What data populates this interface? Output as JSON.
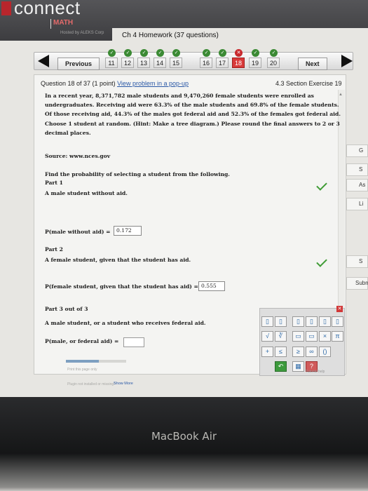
{
  "header": {
    "brand": "connect",
    "product": "MATH",
    "powered_by": "Hosted by ALEKS Corp",
    "assignment_title": "Ch 4 Homework (37 questions)"
  },
  "nav": {
    "previous_label": "Previous",
    "next_label": "Next",
    "questions": [
      "11",
      "12",
      "13",
      "14",
      "15",
      "16",
      "17",
      "18",
      "19",
      "20"
    ],
    "current_question": "18"
  },
  "question": {
    "header_prefix": "Question 18 of 37 (1 point)",
    "popup_link": "View problem in a pop-up",
    "section": "4.3 Section Exercise 19",
    "body": "In a recent year, 8,371,782 male students and 9,470,260 female students were enrolled as undergraduates. Receiving aid were 63.3% of the male students and 69.8% of the female students. Of those receiving aid, 44.3% of the males got federal aid and 52.3% of the females got federal aid. Choose 1 student at random. (Hint: Make a tree diagram.) Please round the final answers to 2 or 3 decimal places.",
    "source": "Source: www.nces.gov",
    "instruction": "Find the probability of selecting a student from the following."
  },
  "parts": {
    "part1_title": "Part 1",
    "part1_text": "A male student without aid.",
    "part1_label": "P(male without aid) =",
    "part1_answer": "0.172",
    "part2_title": "Part 2",
    "part2_text": "A female student, given that the student has aid.",
    "part2_label": "P(female student, given that the student has aid) =",
    "part2_answer": "0.555",
    "part3_title": "Part 3 out of 3",
    "part3_text": "A male student, or a student who receives federal aid.",
    "part3_label": "P(male, or federal aid) ="
  },
  "side_tabs": [
    "G",
    "S",
    "As",
    "Li",
    "S",
    "Subm"
  ],
  "keypad": {
    "keys_row2": [
      "+",
      "≤",
      "≥",
      "∞",
      "()"
    ],
    "keys_row1_symbols": [
      "×",
      "π"
    ],
    "help_label": "Tutorial help"
  },
  "footer": {
    "print_label": "Print this page only",
    "problem_text": "Plugin not installed or missing?",
    "show_more": "Show More",
    "progress_fraction": 0.55
  },
  "device_label": "MacBook Air"
}
